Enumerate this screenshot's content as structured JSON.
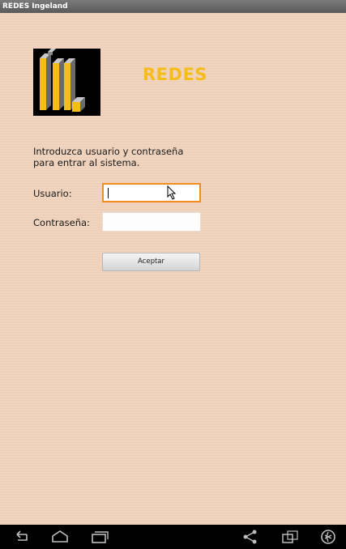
{
  "window": {
    "title": "REDES Ingeland"
  },
  "header": {
    "app_name": "REDES"
  },
  "login": {
    "intro": "Introduzca usuario y contraseña para entrar al sistema.",
    "user_label": "Usuario:",
    "user_value": "",
    "password_label": "Contraseña:",
    "password_value": "",
    "submit_label": "Aceptar"
  },
  "navbar": {
    "icons": [
      "back-icon",
      "home-icon",
      "recent-apps-icon",
      "share-icon",
      "screen-rotate-icon",
      "settings-icon"
    ]
  },
  "colors": {
    "background": "#f1d2bb",
    "brand_yellow": "#f5bd1c",
    "focus_border": "#f28c1e",
    "titlebar": "#6a6a6a"
  }
}
